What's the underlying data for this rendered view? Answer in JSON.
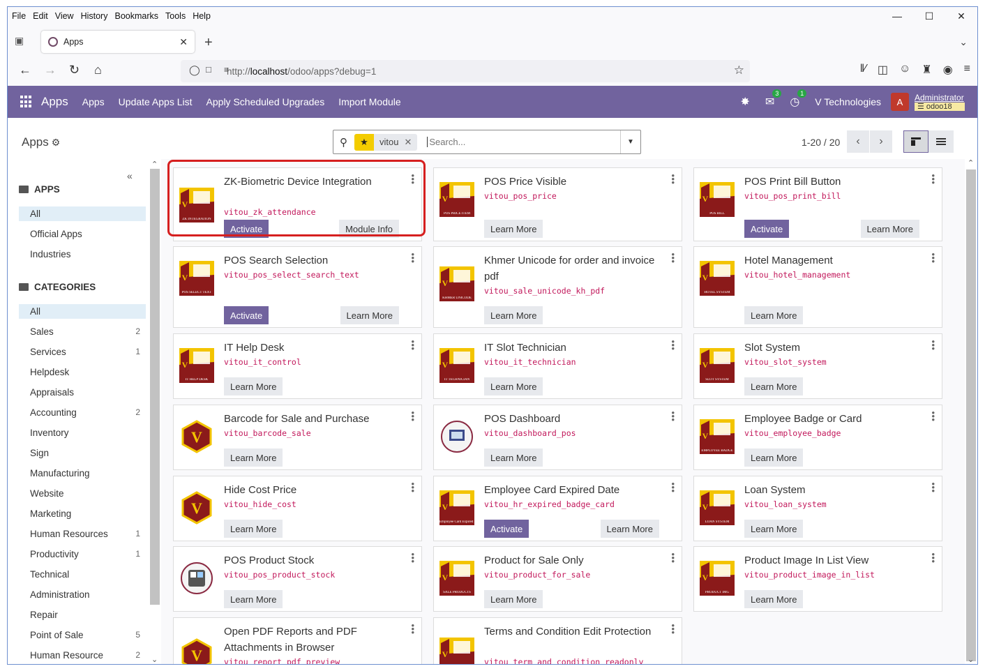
{
  "browser": {
    "menu": [
      "File",
      "Edit",
      "View",
      "History",
      "Bookmarks",
      "Tools",
      "Help"
    ],
    "tab_title": "Apps",
    "url_prefix": "http://",
    "url_host": "localhost",
    "url_path": "/odoo/apps?debug=1"
  },
  "odoo_nav": {
    "brand": "Apps",
    "menu": [
      "Apps",
      "Update Apps List",
      "Apply Scheduled Upgrades",
      "Import Module"
    ],
    "messages_count": "3",
    "activities_count": "1",
    "company": "V Technologies",
    "avatar_letter": "A",
    "user": "Administrator",
    "db": "odoo18"
  },
  "control_panel": {
    "title": "Apps",
    "facet_value": "vitou",
    "search_placeholder": "Search...",
    "pager": "1-20 / 20"
  },
  "sidebar": {
    "apps_header": "APPS",
    "apps": [
      {
        "label": "All",
        "count": "",
        "selected": true
      },
      {
        "label": "Official Apps",
        "count": ""
      },
      {
        "label": "Industries",
        "count": ""
      }
    ],
    "categories_header": "CATEGORIES",
    "categories": [
      {
        "label": "All",
        "count": "",
        "selected": true
      },
      {
        "label": "Sales",
        "count": "2"
      },
      {
        "label": "Services",
        "count": "1"
      },
      {
        "label": "Helpdesk",
        "count": ""
      },
      {
        "label": "Appraisals",
        "count": ""
      },
      {
        "label": "Accounting",
        "count": "2"
      },
      {
        "label": "Inventory",
        "count": ""
      },
      {
        "label": "Sign",
        "count": ""
      },
      {
        "label": "Manufacturing",
        "count": ""
      },
      {
        "label": "Website",
        "count": ""
      },
      {
        "label": "Marketing",
        "count": ""
      },
      {
        "label": "Human Resources",
        "count": "1"
      },
      {
        "label": "Productivity",
        "count": "1"
      },
      {
        "label": "Technical",
        "count": ""
      },
      {
        "label": "Administration",
        "count": ""
      },
      {
        "label": "Repair",
        "count": ""
      },
      {
        "label": "Point of Sale",
        "count": "5"
      },
      {
        "label": "Human Resource",
        "count": "2"
      }
    ]
  },
  "apps": [
    {
      "name": "ZK-Biometric Device Integration",
      "tech": "vitou_zk_attendance",
      "logo_text": "ZK INTEGRATION",
      "primary": "Activate",
      "secondary": "Module Info"
    },
    {
      "name": "POS Price Visible",
      "tech": "vitou_pos_price",
      "logo_text": "POS PRICE ITEM",
      "primary": "",
      "secondary": "Learn More"
    },
    {
      "name": "POS Print Bill Button",
      "tech": "vitou_pos_print_bill",
      "logo_text": "POS BILL",
      "primary": "Activate",
      "secondary": "Learn More"
    },
    {
      "name": "POS Search Selection",
      "tech": "vitou_pos_select_search_text",
      "logo_text": "POS SELECT TEXT",
      "primary": "Activate",
      "secondary": "Learn More"
    },
    {
      "name": "Khmer Unicode for order and invoice pdf",
      "tech": "vitou_sale_unicode_kh_pdf",
      "logo_text": "KHMER UNICODE",
      "primary": "",
      "secondary": "Learn More"
    },
    {
      "name": "Hotel Management",
      "tech": "vitou_hotel_management",
      "logo_text": "HOTEL SYSTEM",
      "primary": "",
      "secondary": "Learn More"
    },
    {
      "name": "IT Help Desk",
      "tech": "vitou_it_control",
      "logo_text": "IT HELP DESK",
      "primary": "",
      "secondary": "Learn More"
    },
    {
      "name": "IT Slot Technician",
      "tech": "vitou_it_technician",
      "logo_text": "IT TECHNICIAN",
      "primary": "",
      "secondary": "Learn More"
    },
    {
      "name": "Slot System",
      "tech": "vitou_slot_system",
      "logo_text": "SLOT SYSTEM",
      "primary": "",
      "secondary": "Learn More"
    },
    {
      "name": "Barcode for Sale and Purchase",
      "tech": "vitou_barcode_sale",
      "logo_text": "",
      "primary": "",
      "secondary": "Learn More"
    },
    {
      "name": "POS Dashboard",
      "tech": "vitou_dashboard_pos",
      "logo_text": "",
      "primary": "",
      "secondary": "Learn More"
    },
    {
      "name": "Employee Badge or Card",
      "tech": "vitou_employee_badge",
      "logo_text": "EMPLOYEE BADGE",
      "primary": "",
      "secondary": "Learn More"
    },
    {
      "name": "Hide Cost Price",
      "tech": "vitou_hide_cost",
      "logo_text": "",
      "primary": "",
      "secondary": "Learn More"
    },
    {
      "name": "Employee Card Expired Date",
      "tech": "vitou_hr_expired_badge_card",
      "logo_text": "Employee Card Expired Date",
      "primary": "Activate",
      "secondary": "Learn More"
    },
    {
      "name": "Loan System",
      "tech": "vitou_loan_system",
      "logo_text": "LOAN SYSTEM",
      "primary": "",
      "secondary": "Learn More"
    },
    {
      "name": "POS Product Stock",
      "tech": "vitou_pos_product_stock",
      "logo_text": "",
      "primary": "",
      "secondary": "Learn More"
    },
    {
      "name": "Product for Sale Only",
      "tech": "vitou_product_for_sale",
      "logo_text": "SALE PRODUCTS",
      "primary": "",
      "secondary": "Learn More"
    },
    {
      "name": "Product Image In List View",
      "tech": "vitou_product_image_in_list",
      "logo_text": "PRODUCT IMG",
      "primary": "",
      "secondary": "Learn More"
    },
    {
      "name": "Open PDF Reports and PDF Attachments in Browser",
      "tech": "vitou_report_pdf_preview",
      "logo_text": "",
      "primary": "",
      "secondary": ""
    },
    {
      "name": "Terms and Condition Edit Protection",
      "tech": "vitou_term_and_condition_readonly",
      "logo_text": "Terms & Condition",
      "primary": "",
      "secondary": ""
    }
  ]
}
